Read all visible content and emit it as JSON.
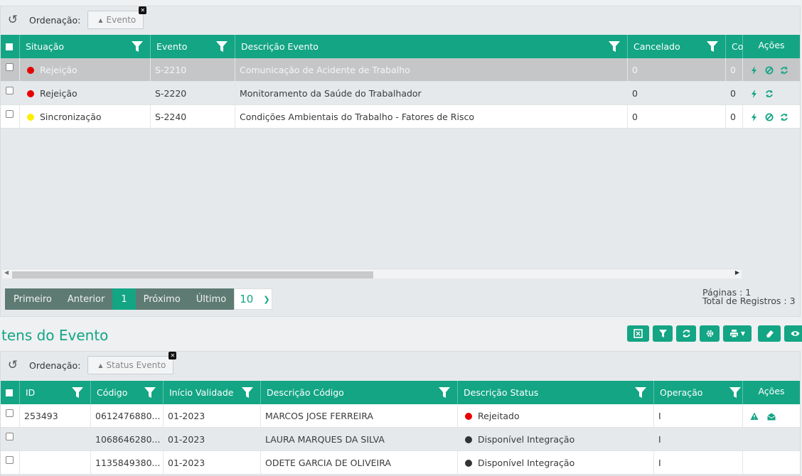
{
  "top": {
    "ordenacao_label": "Ordenação:",
    "ordenacao_chip": "Evento",
    "columns": [
      "Situação",
      "Evento",
      "Descrição Evento",
      "Cancelado",
      "Co",
      "Ações"
    ],
    "rows": [
      {
        "situacao": "Rejeição",
        "status_color": "#e60000",
        "evento": "S-2210",
        "descricao": "Comunicação de Acidente de Trabalho",
        "cancelado": "0",
        "co": "0",
        "actions": [
          "bolt-icon",
          "ban-icon",
          "sync-icon"
        ]
      },
      {
        "situacao": "Rejeição",
        "status_color": "#e60000",
        "evento": "S-2220",
        "descricao": "Monitoramento da Saúde do Trabalhador",
        "cancelado": "0",
        "co": "0",
        "actions": [
          "bolt-icon",
          "sync-icon"
        ]
      },
      {
        "situacao": "Sincronização",
        "status_color": "#ffee00",
        "evento": "S-2240",
        "descricao": "Condições Ambientais do Trabalho - Fatores de Risco",
        "cancelado": "0",
        "co": "0",
        "actions": [
          "bolt-icon",
          "ban-icon",
          "sync-icon"
        ]
      }
    ],
    "pager": {
      "first": "Primeiro",
      "prev": "Anterior",
      "current": "1",
      "next": "Próximo",
      "last": "Último",
      "page_size": "10",
      "pages_text": "Páginas : 1",
      "total_text": "Total de Registros : 3"
    }
  },
  "itens": {
    "title": "tens do Evento",
    "toolbar_icons": [
      "excel-icon",
      "filter-icon",
      "refresh-icon",
      "gear-icon",
      "print-icon",
      "eraser-icon",
      "eye-icon"
    ],
    "ordenacao_label": "Ordenação:",
    "ordenacao_chip": "Status Evento",
    "columns": [
      "ID",
      "Código",
      "Início Validade",
      "Descrição Código",
      "Descrição Status",
      "Operação",
      "Ações"
    ],
    "rows": [
      {
        "id": "253493",
        "codigo": "0612476880...",
        "inicio": "01-2023",
        "descricao": "MARCOS JOSE FERREIRA",
        "status": "Rejeitado",
        "status_color": "#e60000",
        "operacao": "I",
        "actions": [
          "warning-icon",
          "envelope-open-icon"
        ]
      },
      {
        "id": "",
        "codigo": "1068646280...",
        "inicio": "01-2023",
        "descricao": "LAURA MARQUES DA SILVA",
        "status": "Disponível Integração",
        "status_color": "#333333",
        "operacao": "I",
        "actions": []
      },
      {
        "id": "",
        "codigo": "1135849380...",
        "inicio": "01-2023",
        "descricao": "ODETE GARCIA DE OLIVEIRA",
        "status": "Disponível Integração",
        "status_color": "#333333",
        "operacao": "I",
        "actions": []
      }
    ]
  },
  "colors": {
    "accent": "#13a584",
    "pager_dark": "#5d7b72",
    "row_selected": "#c4c6c8"
  }
}
